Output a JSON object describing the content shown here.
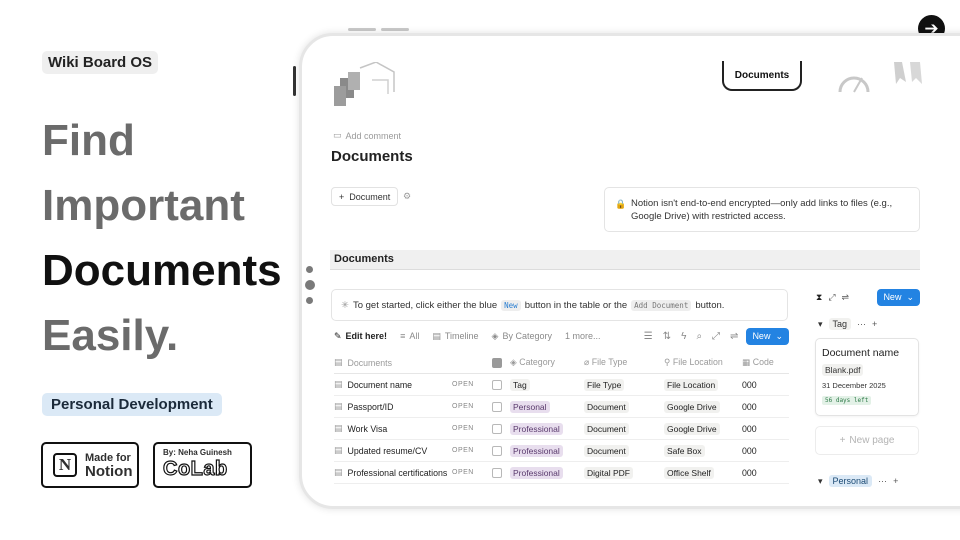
{
  "brand": "Wiki Board OS",
  "headline": [
    "Find",
    "Important",
    "Documents",
    "Easily."
  ],
  "category_tag": "Personal Development",
  "badge_notion": {
    "small": "Made for",
    "big": "Notion"
  },
  "badge_colab": {
    "by": "By: Neha Guinesh",
    "name": "CoLab"
  },
  "page": {
    "tab_label": "Documents",
    "add_comment": "Add comment",
    "title": "Documents",
    "add_document_button": "Document",
    "callout": "Notion isn't end-to-end encrypted—only add links to files (e.g., Google Drive) with restricted access.",
    "section_heading": "Documents",
    "tip": {
      "before": "To get started, click either the blue",
      "code_new": "New",
      "middle": "button in the table or the",
      "code_add": "Add Document",
      "after": "button."
    }
  },
  "toolbar": {
    "views": [
      {
        "label": "Edit here!",
        "icon": "pencil-icon"
      },
      {
        "label": "All",
        "icon": "database-icon"
      },
      {
        "label": "Timeline",
        "icon": "timeline-icon"
      },
      {
        "label": "By Category",
        "icon": "stack-icon"
      },
      {
        "label": "1 more...",
        "icon": ""
      }
    ],
    "new_label": "New"
  },
  "table": {
    "columns": [
      "Documents",
      "Category",
      "File Type",
      "File Location",
      "Code"
    ],
    "open_label": "OPEN",
    "rows": [
      {
        "name": "Document name",
        "category": "Tag",
        "file_type": "File Type",
        "location": "File Location",
        "code": "000"
      },
      {
        "name": "Passport/ID",
        "category": "Personal",
        "file_type": "Document",
        "location": "Google Drive",
        "code": "000"
      },
      {
        "name": "Work Visa",
        "category": "Professional",
        "file_type": "Document",
        "location": "Google Drive",
        "code": "000"
      },
      {
        "name": "Updated resume/CV",
        "category": "Professional",
        "file_type": "Document",
        "location": "Safe Box",
        "code": "000"
      },
      {
        "name": "Professional certifications",
        "category": "Professional",
        "file_type": "Digital PDF",
        "location": "Office Shelf",
        "code": "000"
      }
    ]
  },
  "board": {
    "new_label": "New",
    "group_tag": "Tag",
    "card": {
      "name": "Document name",
      "file": "Blank.pdf",
      "date": "31 December 2025",
      "days_left": "56 days left"
    },
    "new_page": "New page",
    "group_personal": "Personal"
  },
  "colors": {
    "accent": "#2383e2",
    "purple_pill": "#e8deee",
    "blue_pill": "#dbe9f6"
  }
}
